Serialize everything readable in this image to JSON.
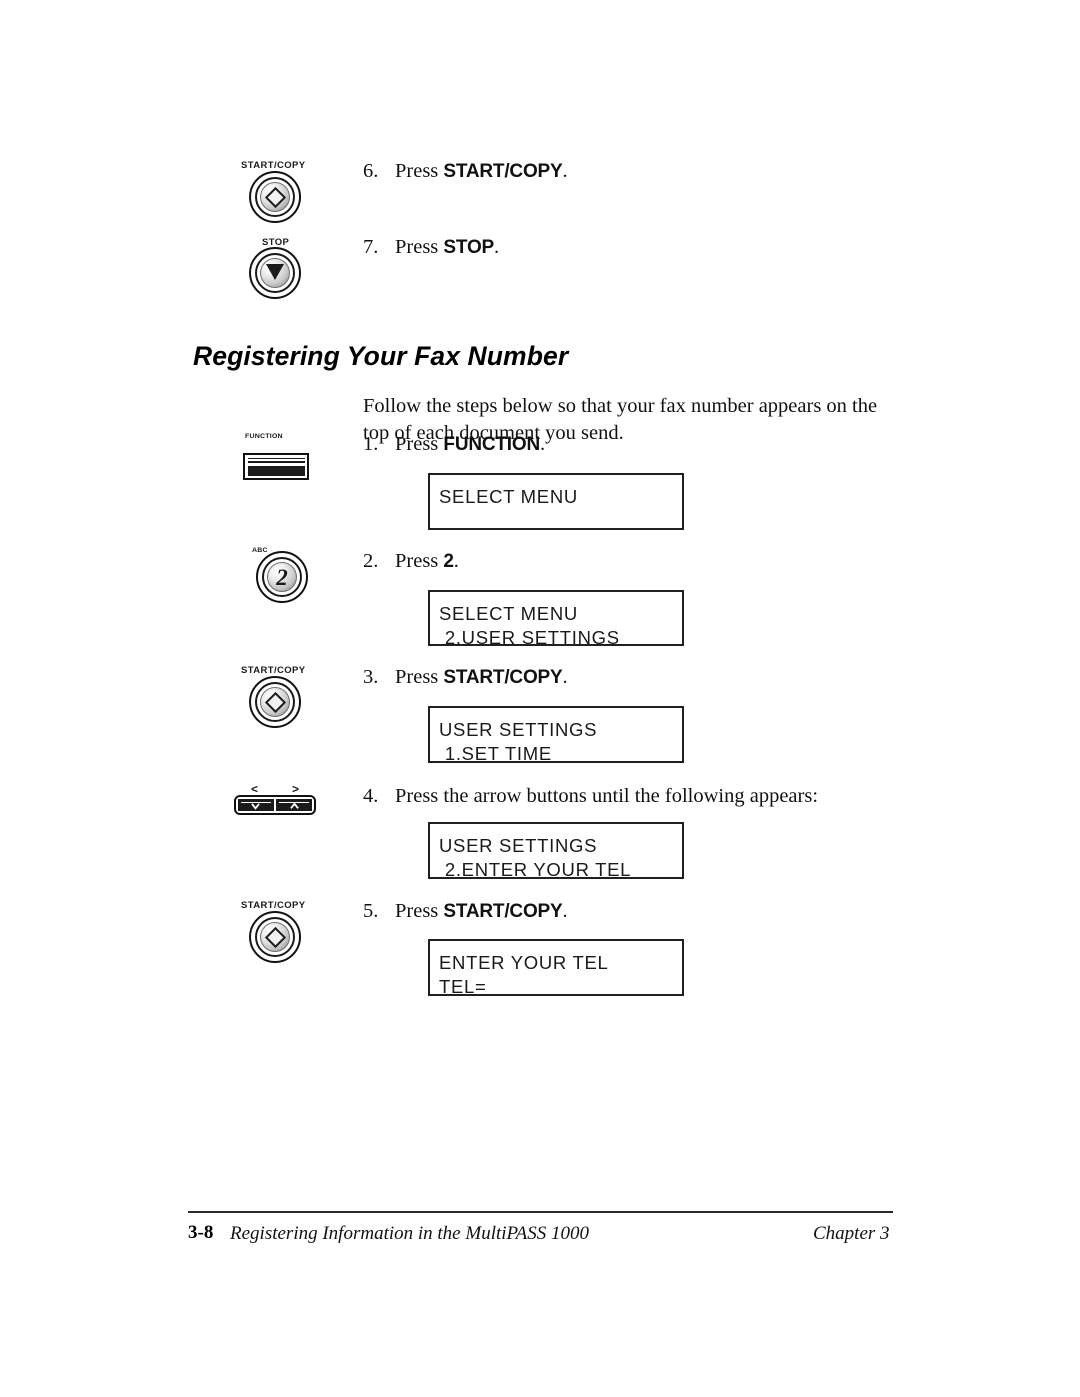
{
  "document": {
    "heading": "Registering Your Fax Number",
    "intro": "Follow the steps below so that your fax number appears on the top of each document you send."
  },
  "top_steps": [
    {
      "number": "6.",
      "prefix": "Press ",
      "bold": "START/COPY",
      "suffix": ".",
      "icon": "start-copy-button",
      "icon_caption": "START/COPY"
    },
    {
      "number": "7.",
      "prefix": "Press ",
      "bold": "STOP",
      "suffix": ".",
      "icon": "stop-button",
      "icon_caption": "STOP"
    }
  ],
  "steps": [
    {
      "number": "1.",
      "prefix": "Press ",
      "bold": "FUNCTION",
      "suffix": ".",
      "icon": "function-button",
      "icon_caption": "FUNCTION",
      "lcd": {
        "line1": "SELECT MENU",
        "line2": ""
      }
    },
    {
      "number": "2.",
      "prefix": "Press ",
      "bold": "2",
      "suffix": ".",
      "icon": "keypad-2-button",
      "icon_caption": "2",
      "icon_sublabel": "ABC",
      "lcd": {
        "line1": "SELECT MENU",
        "line2": " 2.USER SETTINGS"
      }
    },
    {
      "number": "3.",
      "prefix": "Press ",
      "bold": "START/COPY",
      "suffix": ".",
      "icon": "start-copy-button",
      "icon_caption": "START/COPY",
      "lcd": {
        "line1": "USER SETTINGS",
        "line2": " 1.SET TIME"
      }
    },
    {
      "number": "4.",
      "prefix": "Press the arrow buttons until the following appears:",
      "bold": "",
      "suffix": "",
      "icon": "arrow-buttons",
      "icon_caption": "",
      "arrow_left_mark": "<",
      "arrow_right_mark": ">",
      "lcd": {
        "line1": "USER SETTINGS",
        "line2": " 2.ENTER YOUR TEL"
      }
    },
    {
      "number": "5.",
      "prefix": "Press ",
      "bold": "START/COPY",
      "suffix": ".",
      "icon": "start-copy-button",
      "icon_caption": "START/COPY",
      "lcd": {
        "line1": "ENTER YOUR TEL",
        "line2": "TEL="
      }
    }
  ],
  "footer": {
    "page_number": "3-8",
    "title": "Registering Information in the MultiPASS 1000",
    "chapter": "Chapter 3"
  }
}
